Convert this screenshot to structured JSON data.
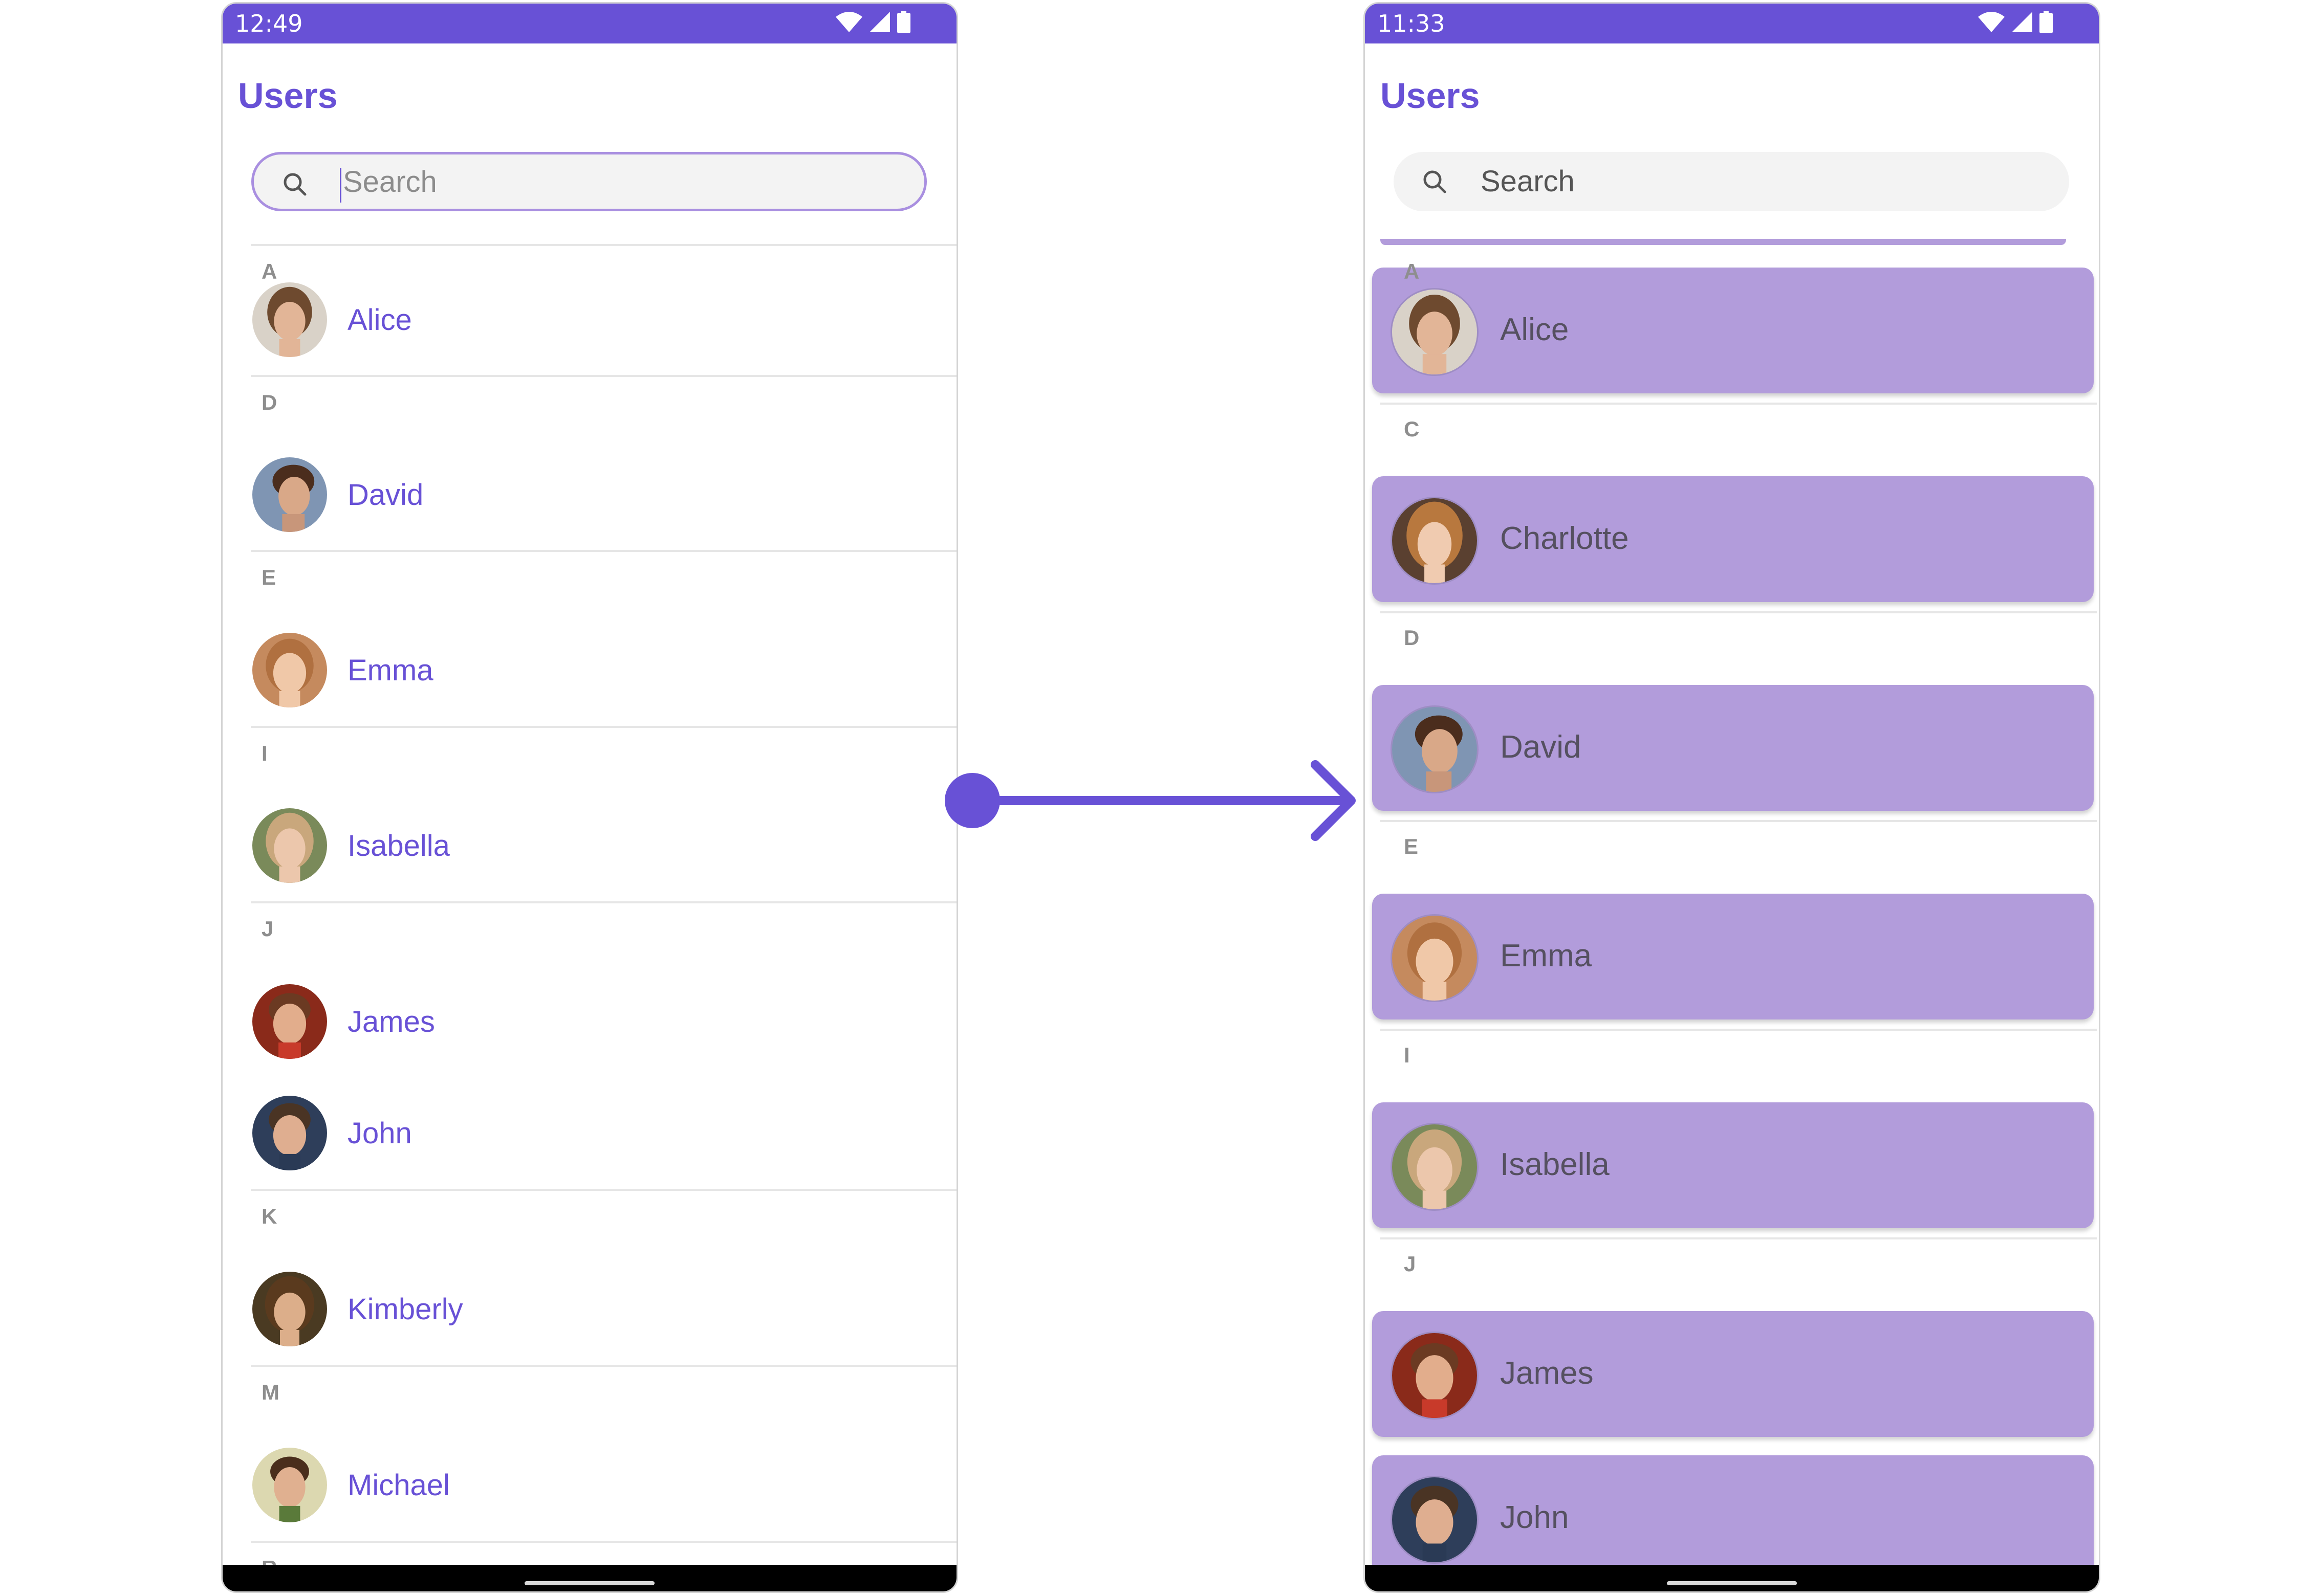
{
  "colors": {
    "accent": "#6851d6",
    "selected_card": "#b29cdb",
    "divider": "#e6e6e6",
    "section_letter": "#8e8e8e"
  },
  "left_screen": {
    "status_time": "12:49",
    "title": "Users",
    "search": {
      "placeholder": "Search",
      "focused": true
    },
    "sections": [
      {
        "letter": "A",
        "users": [
          "Alice"
        ]
      },
      {
        "letter": "D",
        "users": [
          "David"
        ]
      },
      {
        "letter": "E",
        "users": [
          "Emma"
        ]
      },
      {
        "letter": "I",
        "users": [
          "Isabella"
        ]
      },
      {
        "letter": "J",
        "users": [
          "James",
          "John"
        ]
      },
      {
        "letter": "K",
        "users": [
          "Kimberly"
        ]
      },
      {
        "letter": "M",
        "users": [
          "Michael"
        ]
      },
      {
        "letter": "R",
        "users": []
      }
    ]
  },
  "right_screen": {
    "status_time": "11:33",
    "title": "Users",
    "search": {
      "placeholder": "Search",
      "focused": false
    },
    "sections": [
      {
        "letter": "A",
        "users": [
          "Alice"
        ]
      },
      {
        "letter": "C",
        "users": [
          "Charlotte"
        ]
      },
      {
        "letter": "D",
        "users": [
          "David"
        ]
      },
      {
        "letter": "E",
        "users": [
          "Emma"
        ]
      },
      {
        "letter": "I",
        "users": [
          "Isabella"
        ]
      },
      {
        "letter": "J",
        "users": [
          "James",
          "John"
        ]
      }
    ],
    "selected_style": true
  },
  "transition_arrow": {
    "icon": "arrow-right-icon"
  }
}
